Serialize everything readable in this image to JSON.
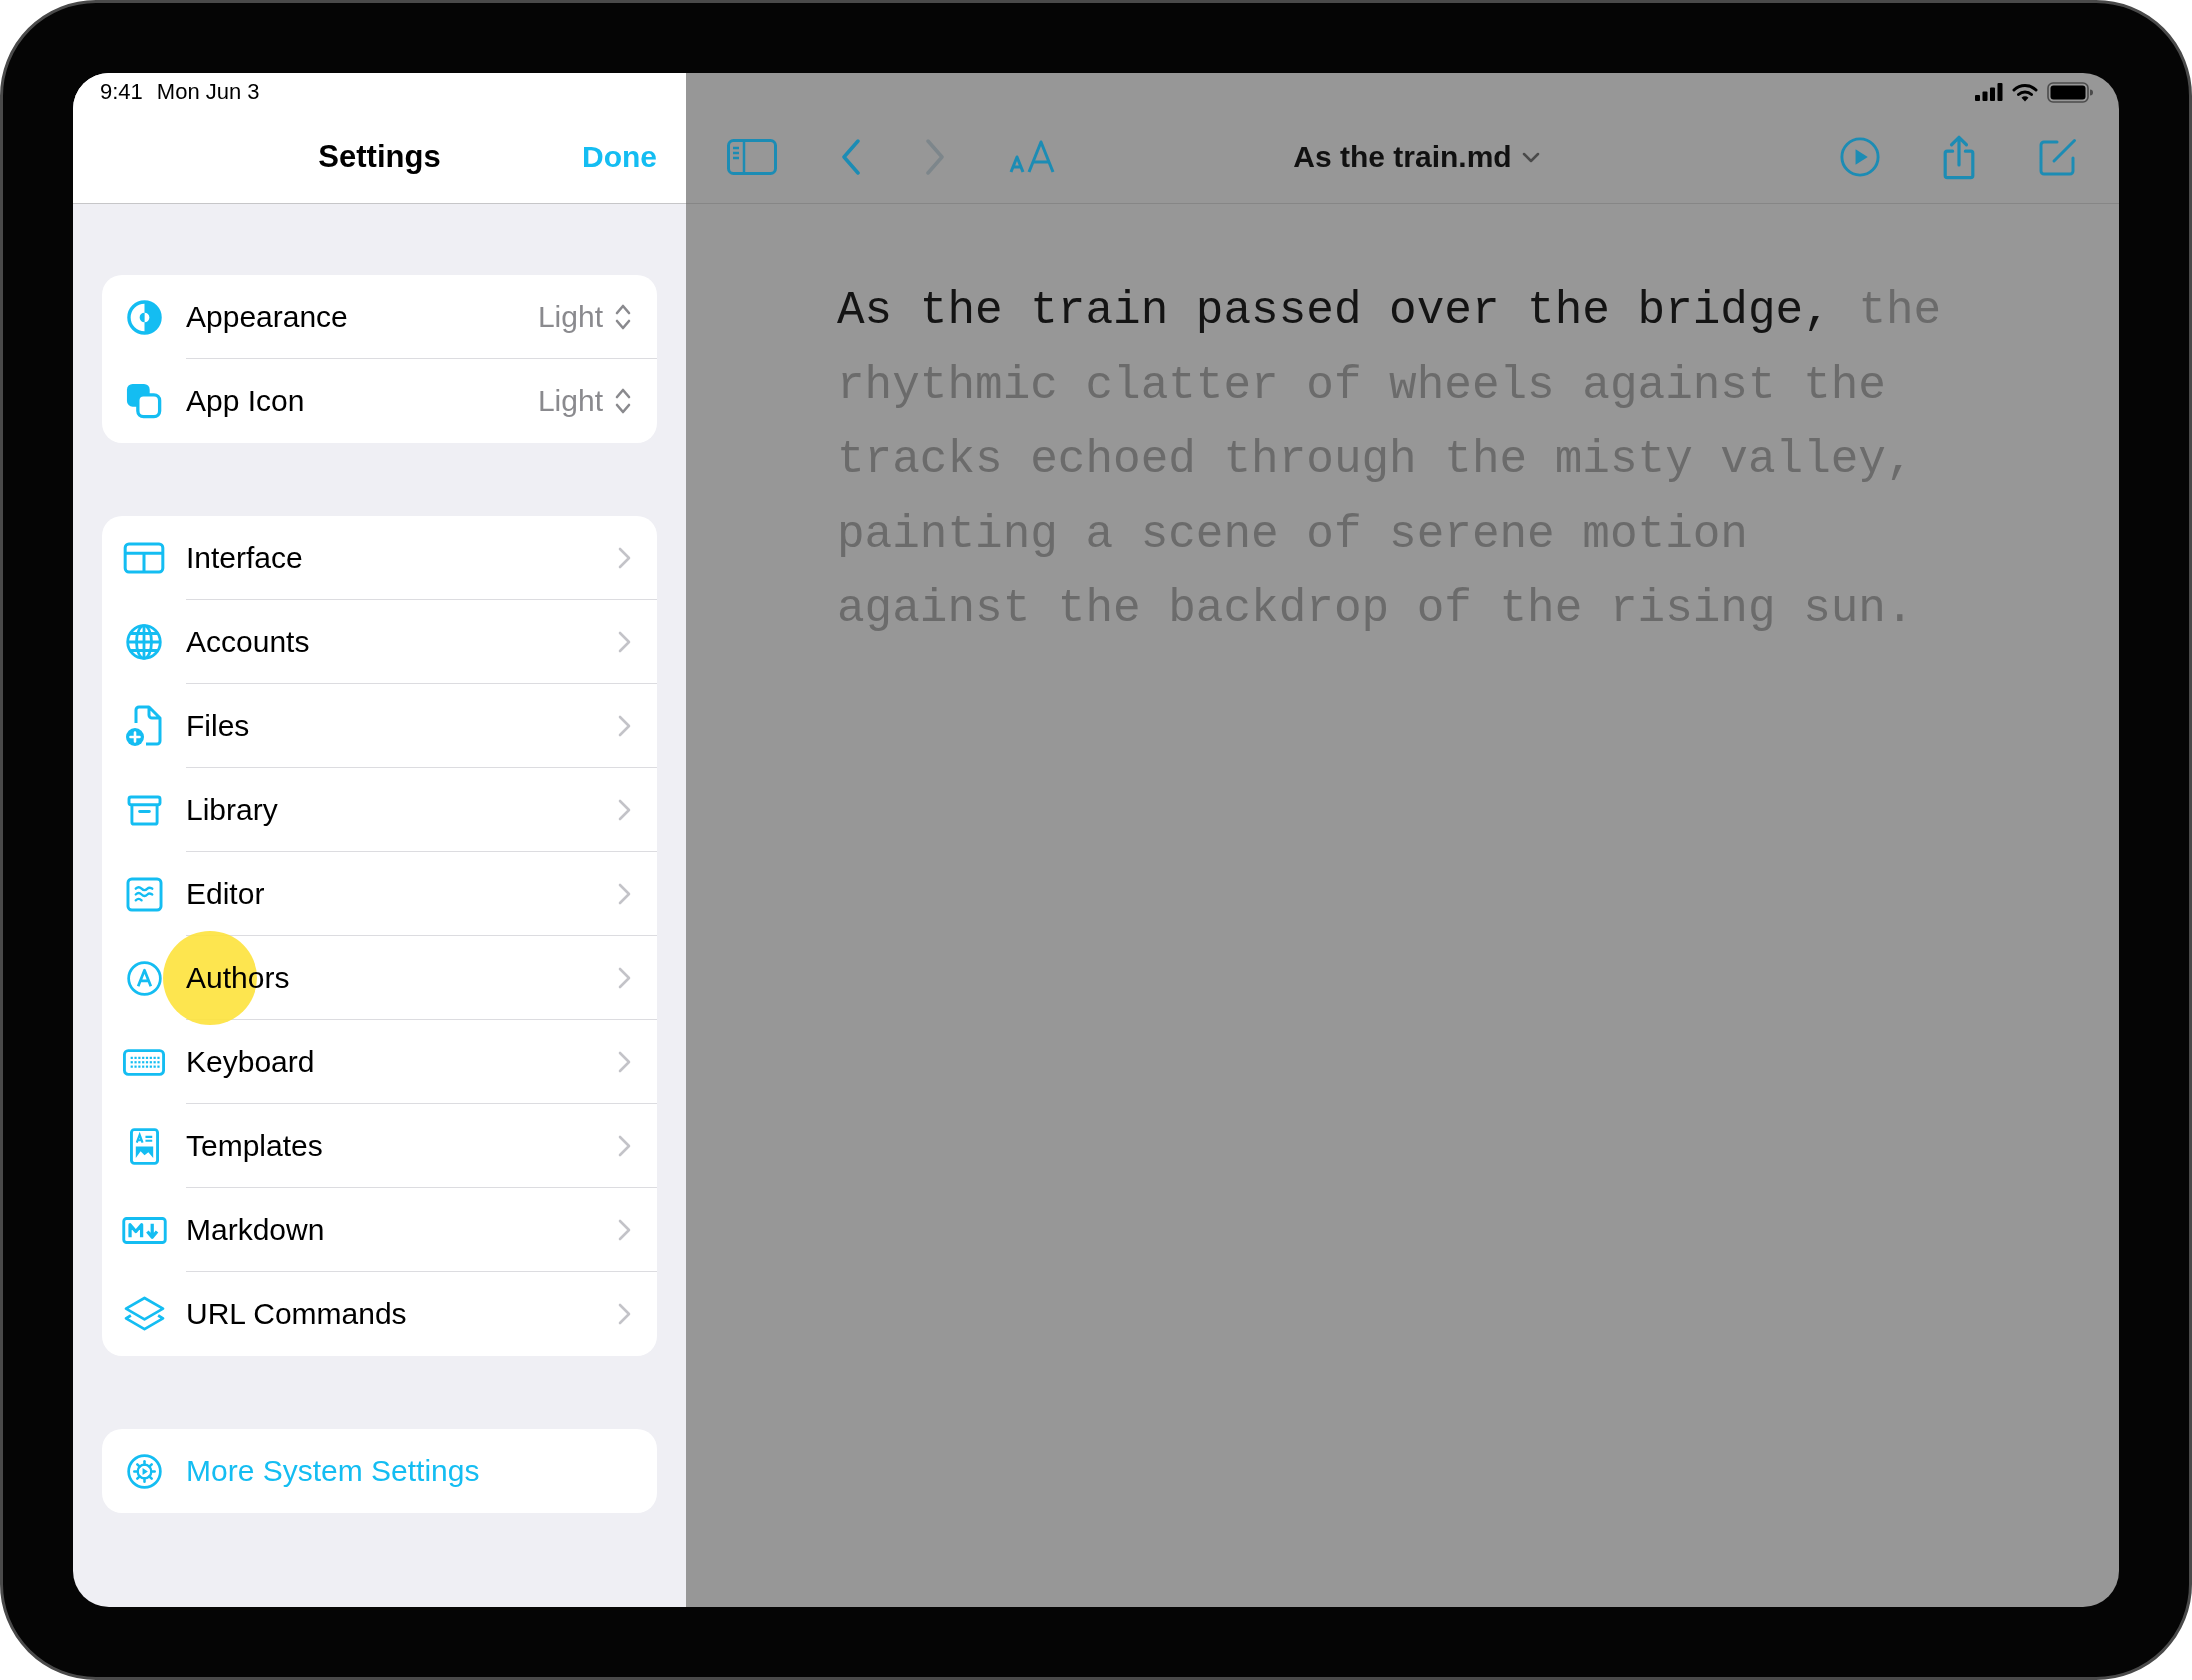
{
  "status_bar": {
    "time": "9:41",
    "date": "Mon Jun 3"
  },
  "settings": {
    "title": "Settings",
    "done": "Done",
    "groups": [
      {
        "rows": [
          {
            "kind": "picker",
            "label": "Appearance",
            "value": "Light",
            "tapped": false
          },
          {
            "kind": "picker",
            "label": "App Icon",
            "value": "Light",
            "tapped": false
          }
        ]
      },
      {
        "rows": [
          {
            "kind": "link",
            "label": "Interface",
            "tapped": false
          },
          {
            "kind": "link",
            "label": "Accounts",
            "tapped": false
          },
          {
            "kind": "link",
            "label": "Files",
            "tapped": false
          },
          {
            "kind": "link",
            "label": "Library",
            "tapped": false
          },
          {
            "kind": "link",
            "label": "Editor",
            "tapped": false
          },
          {
            "kind": "link",
            "label": "Authors",
            "tapped": true
          },
          {
            "kind": "link",
            "label": "Keyboard",
            "tapped": false
          },
          {
            "kind": "link",
            "label": "Templates",
            "tapped": false
          },
          {
            "kind": "link",
            "label": "Markdown",
            "tapped": false
          },
          {
            "kind": "link",
            "label": "URL Commands",
            "tapped": false
          }
        ]
      },
      {
        "rows": [
          {
            "kind": "action",
            "label": "More System Settings",
            "tapped": false
          }
        ]
      }
    ]
  },
  "editor": {
    "toolbar": {
      "back": {
        "disabled": false
      },
      "forward": {
        "disabled": true
      }
    },
    "title": "As the train.md",
    "segments": [
      {
        "text": "As the train passed over the bridge,",
        "focused": true
      },
      {
        "text": "the rhythmic clatter of wheels against the tracks echoed through the misty valley, painting a scene of serene motion against the backdrop of the rising sun.",
        "focused": false
      }
    ]
  }
}
